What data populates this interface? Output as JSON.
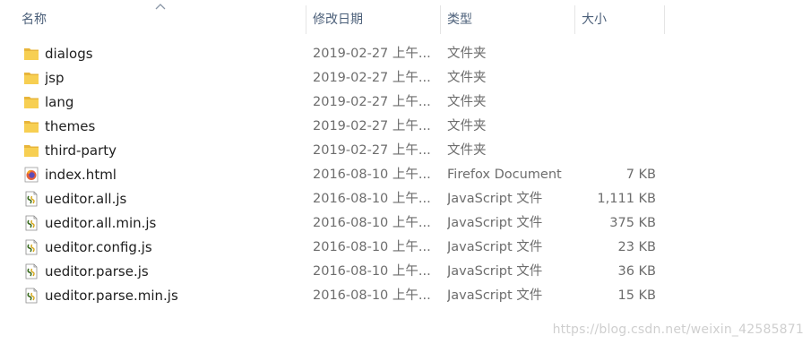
{
  "header": {
    "name_label": "名称",
    "date_label": "修改日期",
    "type_label": "类型",
    "size_label": "大小"
  },
  "files": [
    {
      "name": "dialogs",
      "date": "2019-02-27 上午...",
      "type": "文件夹",
      "size": "",
      "icon": "folder-icon"
    },
    {
      "name": "jsp",
      "date": "2019-02-27 上午...",
      "type": "文件夹",
      "size": "",
      "icon": "folder-icon"
    },
    {
      "name": "lang",
      "date": "2019-02-27 上午...",
      "type": "文件夹",
      "size": "",
      "icon": "folder-icon"
    },
    {
      "name": "themes",
      "date": "2019-02-27 上午...",
      "type": "文件夹",
      "size": "",
      "icon": "folder-icon"
    },
    {
      "name": "third-party",
      "date": "2019-02-27 上午...",
      "type": "文件夹",
      "size": "",
      "icon": "folder-icon"
    },
    {
      "name": "index.html",
      "date": "2016-08-10 上午...",
      "type": "Firefox Document",
      "size": "7 KB",
      "icon": "firefox-icon"
    },
    {
      "name": "ueditor.all.js",
      "date": "2016-08-10 上午...",
      "type": "JavaScript 文件",
      "size": "1,111 KB",
      "icon": "js-file-icon"
    },
    {
      "name": "ueditor.all.min.js",
      "date": "2016-08-10 上午...",
      "type": "JavaScript 文件",
      "size": "375 KB",
      "icon": "js-file-icon"
    },
    {
      "name": "ueditor.config.js",
      "date": "2016-08-10 上午...",
      "type": "JavaScript 文件",
      "size": "23 KB",
      "icon": "js-file-icon"
    },
    {
      "name": "ueditor.parse.js",
      "date": "2016-08-10 上午...",
      "type": "JavaScript 文件",
      "size": "36 KB",
      "icon": "js-file-icon"
    },
    {
      "name": "ueditor.parse.min.js",
      "date": "2016-08-10 上午...",
      "type": "JavaScript 文件",
      "size": "15 KB",
      "icon": "js-file-icon"
    }
  ],
  "watermark": "https://blog.csdn.net/weixin_42585871",
  "colors": {
    "folder": "#f6c542",
    "header_text": "#4c607a",
    "detail_text": "#6d6d6d"
  }
}
